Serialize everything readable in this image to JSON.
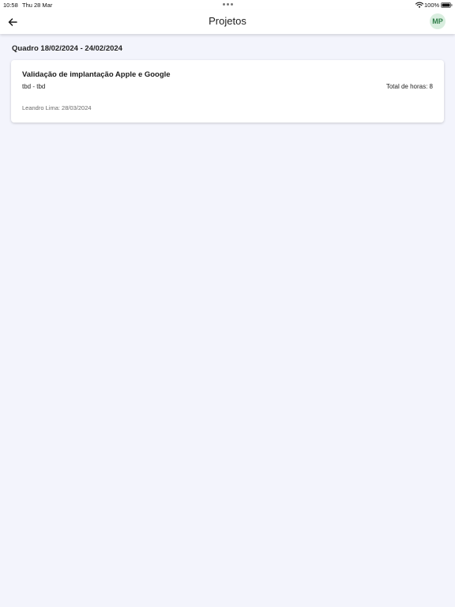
{
  "status_bar": {
    "time": "10:58",
    "date": "Thu 28 Mar",
    "battery": "100%",
    "icons": [
      "wifi-icon",
      "battery-icon",
      "multitasking-dots-icon"
    ]
  },
  "app_bar": {
    "title": "Projetos",
    "back_icon": "arrow-left-icon",
    "avatar_initials": "MP",
    "avatar_color": "#d9eedf",
    "avatar_text_color": "#2e7d47"
  },
  "board": {
    "title": "Quadro 18/02/2024 - 24/02/2024"
  },
  "projects": [
    {
      "name": "Validação de implantação Apple e Google",
      "dates": "tbd - tbd",
      "total_hours": "Total de horas: 8",
      "author": "Leandro Lima: 28/03/2024"
    }
  ],
  "colors": {
    "background": "#f3f4fc",
    "surface": "#ffffff"
  }
}
